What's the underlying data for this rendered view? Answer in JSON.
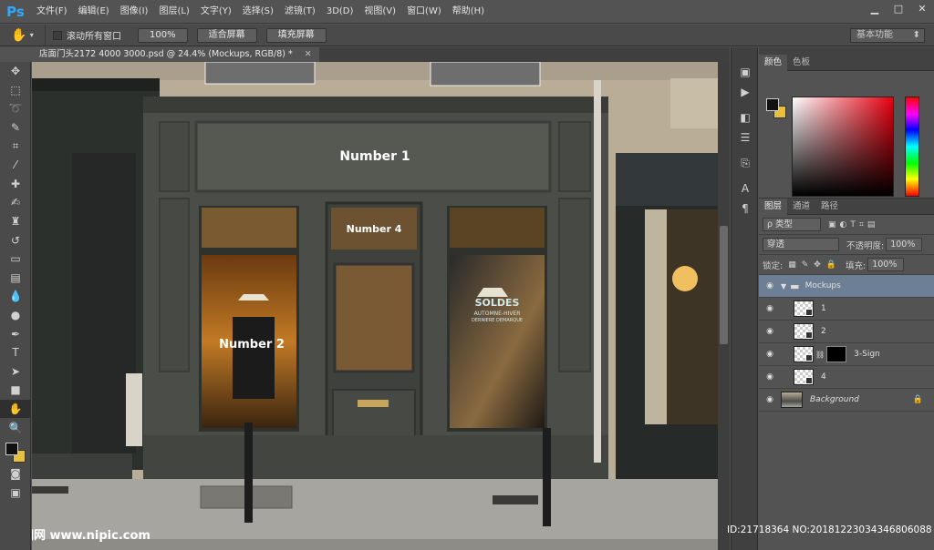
{
  "app": {
    "logo": "Ps"
  },
  "menu": [
    "文件(F)",
    "编辑(E)",
    "图像(I)",
    "图层(L)",
    "文字(Y)",
    "选择(S)",
    "滤镜(T)",
    "3D(D)",
    "视图(V)",
    "窗口(W)",
    "帮助(H)"
  ],
  "options": {
    "scroll_all_windows": "滚动所有窗口",
    "btn_100": "100%",
    "btn_fit": "适合屏幕",
    "btn_fill": "填充屏幕",
    "workspace": "基本功能"
  },
  "document": {
    "tab_title": "店面门头2172 4000 3000.psd @ 24.4% (Mockups, RGB/8) *"
  },
  "canvas_text": {
    "sign1": "Number 1",
    "sign2": "Number 2",
    "sign4": "Number 4",
    "soldes": "SOLDES",
    "soldes_sub": "AUTOMNE-HIVER",
    "soldes_sub2": "DERNIERE DEMARQUE"
  },
  "color_panel": {
    "tab_color": "颜色",
    "tab_swatches": "色板"
  },
  "layers_panel": {
    "tab_layers": "图层",
    "tab_channels": "通道",
    "tab_paths": "路径",
    "filter_kind": "ρ 类型",
    "blend_mode": "穿透",
    "opacity_label": "不透明度:",
    "opacity_value": "100%",
    "lock_label": "锁定:",
    "fill_label": "填充:",
    "fill_value": "100%",
    "layers": [
      {
        "name": "Mockups",
        "type": "group"
      },
      {
        "name": "1",
        "type": "smart"
      },
      {
        "name": "2",
        "type": "smart"
      },
      {
        "name": "3-Sign",
        "type": "smart-mask"
      },
      {
        "name": "4",
        "type": "smart"
      },
      {
        "name": "Background",
        "type": "background"
      }
    ]
  },
  "watermark": {
    "left": "昵图网 www.nipic.com",
    "right": "ID:21718364 NO:20181223034346806088"
  }
}
